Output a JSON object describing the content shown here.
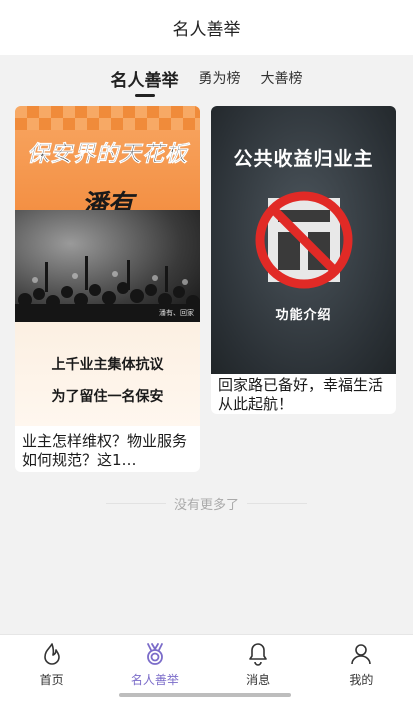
{
  "header": {
    "title": "名人善举"
  },
  "tabs": [
    {
      "label": "名人善举",
      "active": true
    },
    {
      "label": "勇为榜",
      "active": false
    },
    {
      "label": "大善榜",
      "active": false
    }
  ],
  "cards": [
    {
      "cover": {
        "headline": "保安界的天花板",
        "name": "潘有",
        "photo_caption": "潘有、回家",
        "line1": "上千业主集体抗议",
        "line2": "为了留住一名保安"
      },
      "caption": "业主怎样维权？物业服务如何规范？这1…"
    },
    {
      "cover": {
        "headline": "公共收益归业主",
        "subtitle": "功能介绍"
      },
      "caption": "回家路已备好，幸福生活从此起航！"
    }
  ],
  "footer_note": "没有更多了",
  "tabbar": [
    {
      "label": "首页",
      "icon": "fire-icon",
      "active": false
    },
    {
      "label": "名人善举",
      "icon": "medal-icon",
      "active": true
    },
    {
      "label": "消息",
      "icon": "bell-icon",
      "active": false
    },
    {
      "label": "我的",
      "icon": "user-icon",
      "active": false
    }
  ],
  "colors": {
    "accent": "#7b6cc9",
    "orange": "#f28a3c",
    "dark_cover": "#2a3035"
  }
}
